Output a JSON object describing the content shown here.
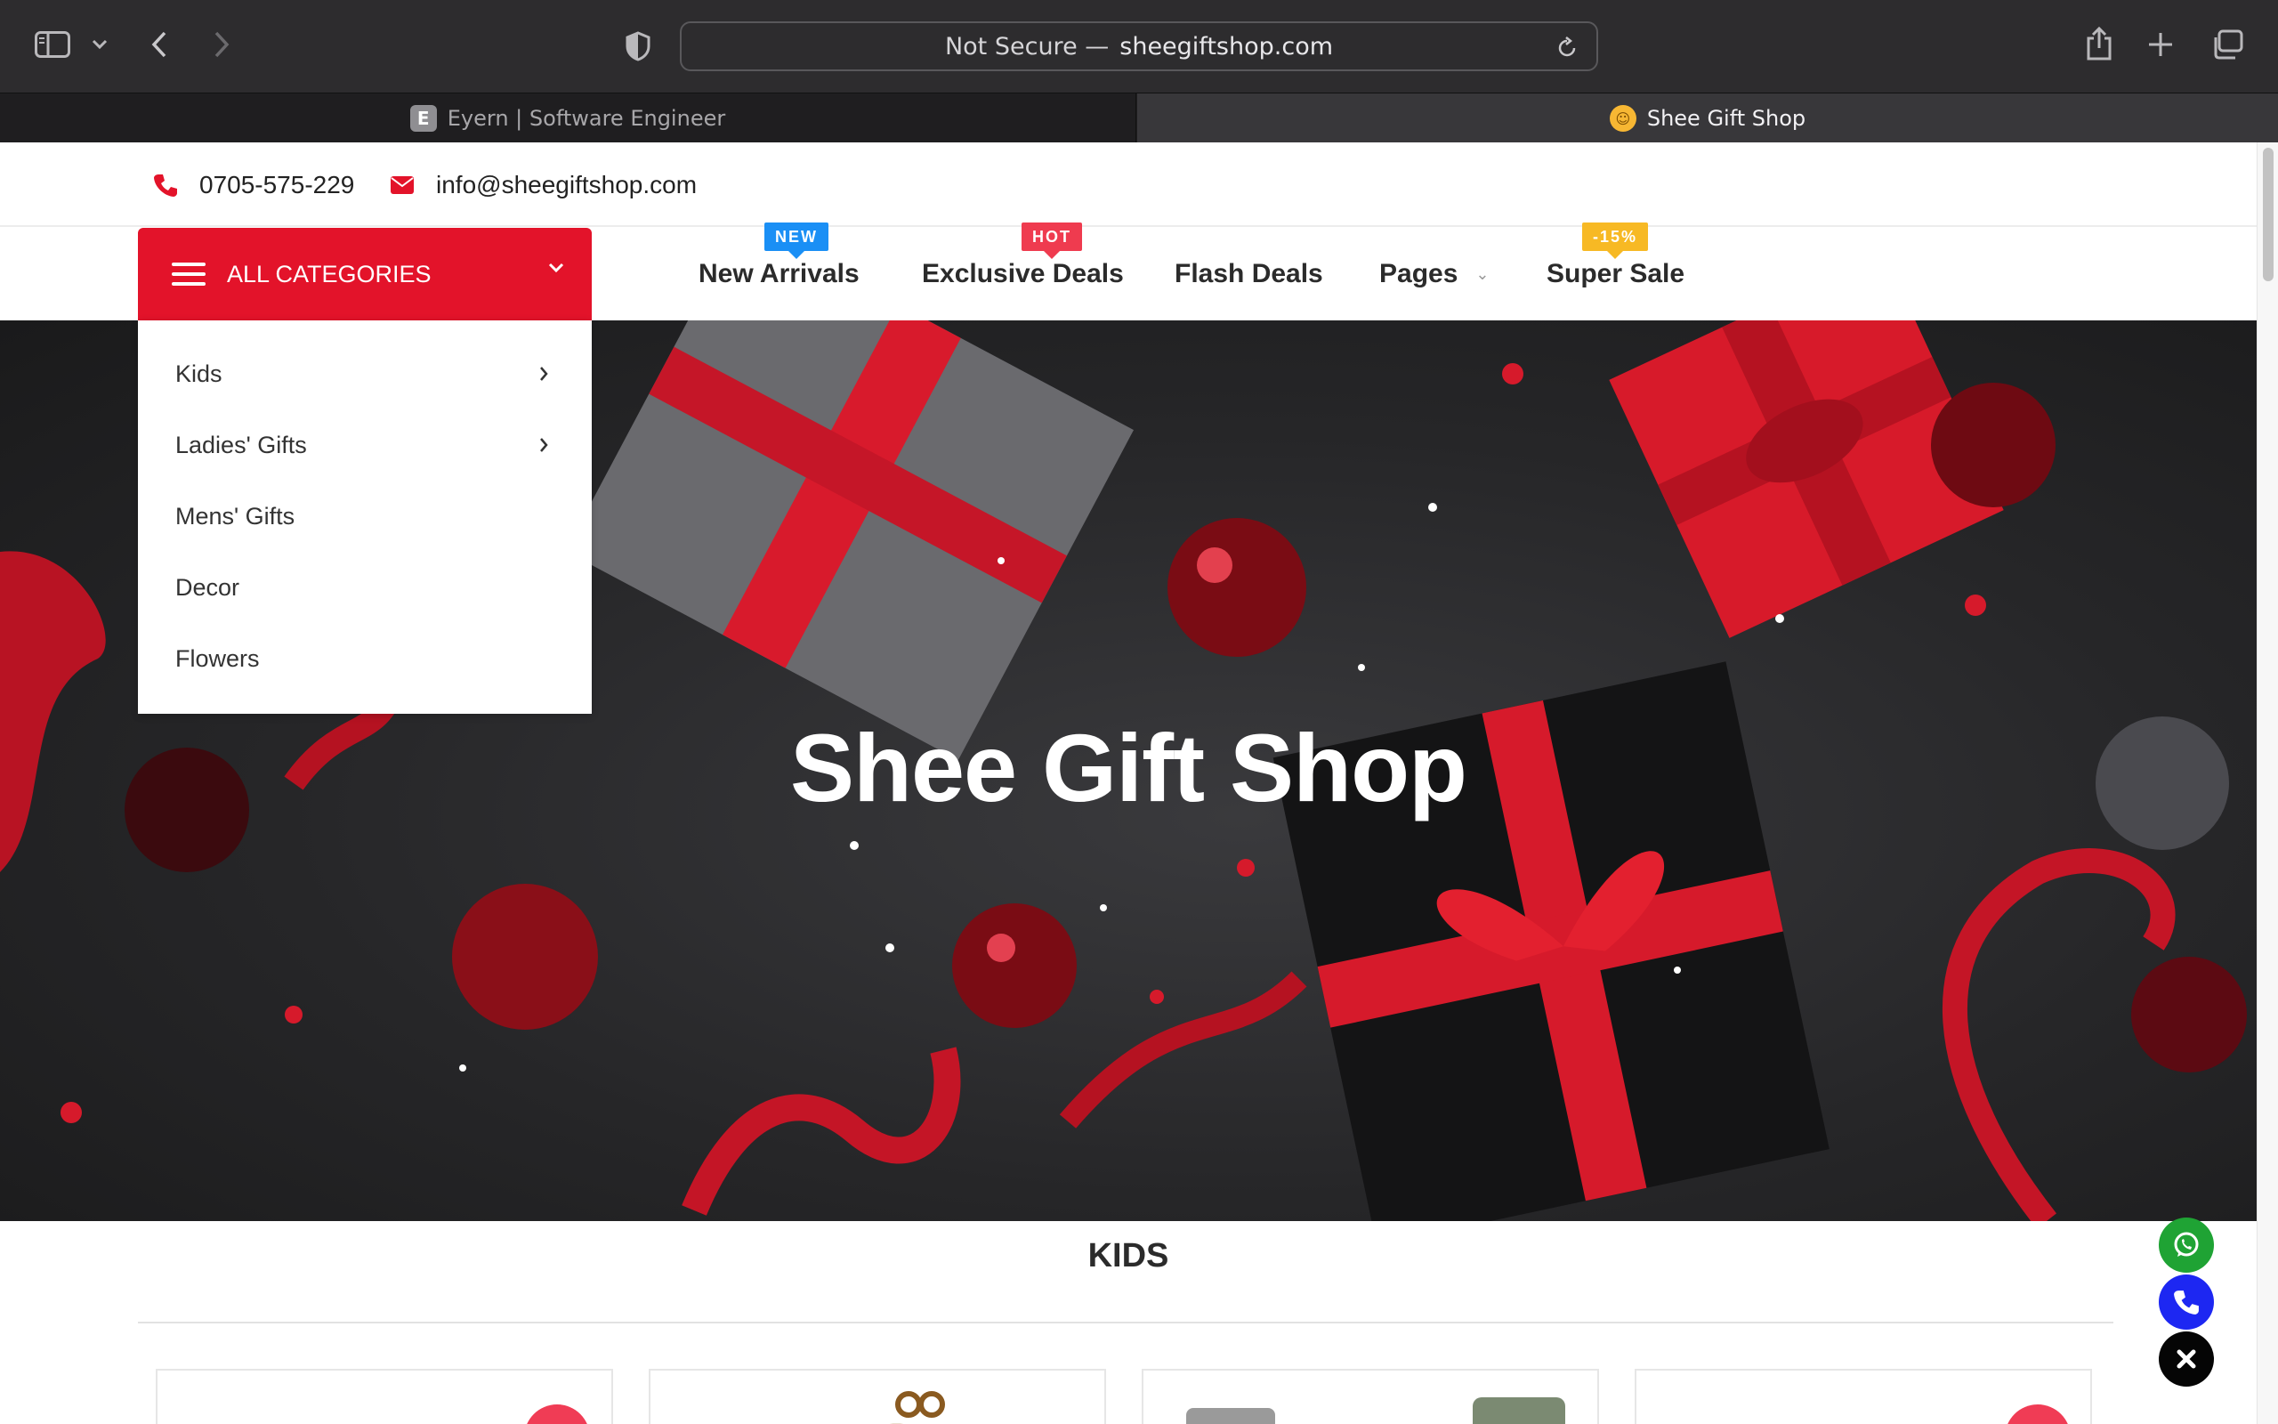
{
  "browser": {
    "url_prefix": "Not Secure —",
    "url_domain": "sheegiftshop.com",
    "tabs": [
      {
        "favicon": "E",
        "title": "Eyern | Software Engineer"
      },
      {
        "favicon": "🤗",
        "title": "Shee Gift Shop"
      }
    ]
  },
  "topbar": {
    "phone": "0705-575-229",
    "email": "info@sheegiftshop.com"
  },
  "nav": {
    "all_categories": "ALL CATEGORIES",
    "links": [
      {
        "label": "New Arrivals",
        "badge": "NEW",
        "badge_color": "#1a8ff5"
      },
      {
        "label": "Exclusive Deals",
        "badge": "HOT",
        "badge_color": "#ef3b4f"
      },
      {
        "label": "Flash Deals"
      },
      {
        "label": "Pages",
        "caret": "⌄"
      },
      {
        "label": "Super Sale",
        "badge": "-15%",
        "badge_color": "#f7b924"
      }
    ]
  },
  "categories": [
    {
      "label": "Kids",
      "has_submenu": true
    },
    {
      "label": "Ladies' Gifts",
      "has_submenu": true
    },
    {
      "label": "Mens' Gifts",
      "has_submenu": false
    },
    {
      "label": "Decor",
      "has_submenu": false
    },
    {
      "label": "Flowers",
      "has_submenu": false
    }
  ],
  "hero": {
    "title": "Shee Gift Shop"
  },
  "section": {
    "title": "KIDS"
  },
  "colors": {
    "brand_red": "#e3132a",
    "whatsapp": "#1fa334",
    "call": "#1d27f2"
  },
  "floating_buttons": [
    "whatsapp-icon",
    "phone-icon",
    "close-icon"
  ]
}
